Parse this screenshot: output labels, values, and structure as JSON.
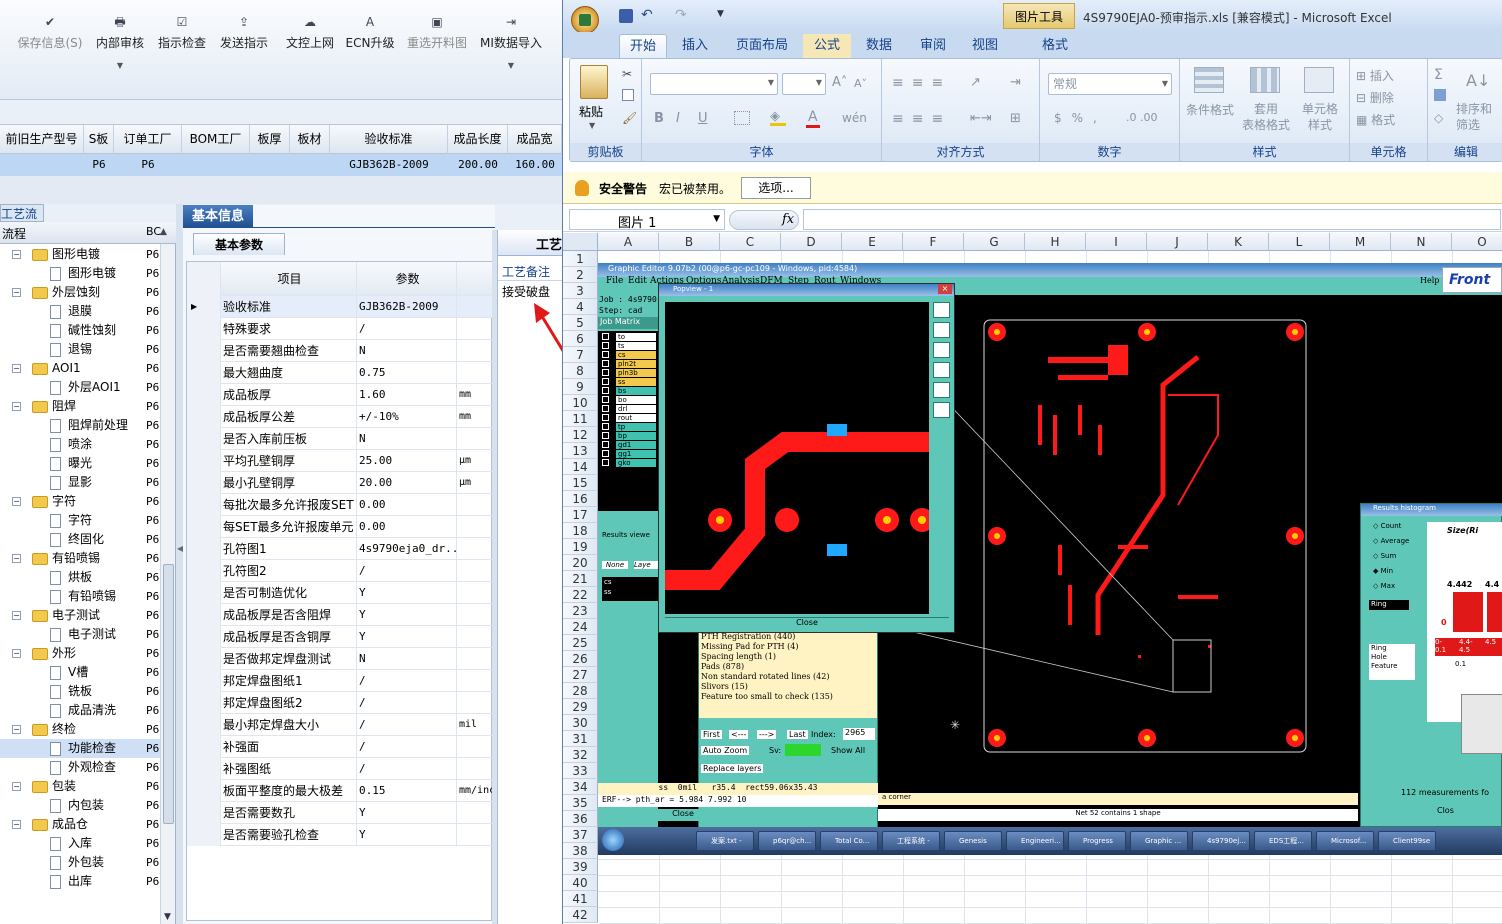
{
  "toolbar": {
    "buttons": [
      {
        "label": "保存信息(S)",
        "icon": "check-icon",
        "enabled": false
      },
      {
        "label": "内部审核",
        "icon": "printer-icon",
        "enabled": true
      },
      {
        "label": "指示检查",
        "icon": "checkbox-icon",
        "enabled": true
      },
      {
        "label": "发送指示",
        "icon": "upload-icon",
        "enabled": true
      },
      {
        "label": "文控上网",
        "icon": "cloud-upload-icon",
        "enabled": true
      },
      {
        "label": "ECN升级",
        "icon": "ecn-icon",
        "enabled": true
      },
      {
        "label": "重选开料图",
        "icon": "image-icon",
        "enabled": false
      },
      {
        "label": "MI数据导入",
        "icon": "import-icon",
        "enabled": true
      }
    ]
  },
  "order_table": {
    "headers": [
      "前旧生产型号",
      "S板",
      "订单工厂",
      "BOM工厂",
      "板厚",
      "板材",
      "验收标准",
      "成品长度",
      "成品宽"
    ],
    "row": [
      "",
      "P6",
      "P6",
      "",
      "",
      "",
      "GJB362B-2009",
      "200.00",
      "160.00"
    ]
  },
  "process": {
    "title": "工艺流程",
    "col1": "流程",
    "col2": "BC",
    "items": [
      {
        "label": "图形电镀",
        "level": 1,
        "code": "P6"
      },
      {
        "label": "图形电镀",
        "level": 2,
        "code": "P6"
      },
      {
        "label": "外层蚀刻",
        "level": 1,
        "code": "P6"
      },
      {
        "label": "退膜",
        "level": 2,
        "code": "P6"
      },
      {
        "label": "碱性蚀刻",
        "level": 2,
        "code": "P6"
      },
      {
        "label": "退锡",
        "level": 2,
        "code": "P6"
      },
      {
        "label": "AOI1",
        "level": 1,
        "code": "P6"
      },
      {
        "label": "外层AOI1",
        "level": 2,
        "code": "P6"
      },
      {
        "label": "阻焊",
        "level": 1,
        "code": "P6"
      },
      {
        "label": "阻焊前处理",
        "level": 2,
        "code": "P6"
      },
      {
        "label": "喷涂",
        "level": 2,
        "code": "P6"
      },
      {
        "label": "曝光",
        "level": 2,
        "code": "P6"
      },
      {
        "label": "显影",
        "level": 2,
        "code": "P6"
      },
      {
        "label": "字符",
        "level": 1,
        "code": "P6"
      },
      {
        "label": "字符",
        "level": 2,
        "code": "P6"
      },
      {
        "label": "终固化",
        "level": 2,
        "code": "P6"
      },
      {
        "label": "有铅喷锡",
        "level": 1,
        "code": "P6"
      },
      {
        "label": "烘板",
        "level": 2,
        "code": "P6"
      },
      {
        "label": "有铅喷锡",
        "level": 2,
        "code": "P6"
      },
      {
        "label": "电子测试",
        "level": 1,
        "code": "P6"
      },
      {
        "label": "电子测试",
        "level": 2,
        "code": "P6"
      },
      {
        "label": "外形",
        "level": 1,
        "code": "P6"
      },
      {
        "label": "V槽",
        "level": 2,
        "code": "P6"
      },
      {
        "label": "铣板",
        "level": 2,
        "code": "P6"
      },
      {
        "label": "成品清洗",
        "level": 2,
        "code": "P6"
      },
      {
        "label": "终检",
        "level": 1,
        "code": "P6"
      },
      {
        "label": "功能检查",
        "level": 2,
        "code": "P6",
        "selected": true
      },
      {
        "label": "外观检查",
        "level": 2,
        "code": "P6"
      },
      {
        "label": "包装",
        "level": 1,
        "code": "P6"
      },
      {
        "label": "内包装",
        "level": 2,
        "code": "P6"
      },
      {
        "label": "成品仓",
        "level": 1,
        "code": "P6"
      },
      {
        "label": "入库",
        "level": 2,
        "code": "P6"
      },
      {
        "label": "外包装",
        "level": 2,
        "code": "P6"
      },
      {
        "label": "出库",
        "level": 2,
        "code": "P6"
      }
    ]
  },
  "basic_info": {
    "tab": "基本信息",
    "subtab": "基本参数",
    "col_item": "项目",
    "col_param": "参数",
    "rows": [
      {
        "k": "验收标准",
        "v": "GJB362B-2009",
        "u": ""
      },
      {
        "k": "特殊要求",
        "v": "/",
        "u": ""
      },
      {
        "k": "是否需要翘曲检查",
        "v": "N",
        "u": ""
      },
      {
        "k": "最大翘曲度",
        "v": "0.75",
        "u": ""
      },
      {
        "k": "成品板厚",
        "v": "1.60",
        "u": "mm"
      },
      {
        "k": "成品板厚公差",
        "v": "+/-10%",
        "u": "mm"
      },
      {
        "k": "是否入库前压板",
        "v": "N",
        "u": ""
      },
      {
        "k": "平均孔壁铜厚",
        "v": "25.00",
        "u": "μm"
      },
      {
        "k": "最小孔壁铜厚",
        "v": "20.00",
        "u": "μm"
      },
      {
        "k": "每批次最多允许报废SET",
        "v": "0.00",
        "u": ""
      },
      {
        "k": "每SET最多允许报废单元",
        "v": "0.00",
        "u": ""
      },
      {
        "k": "孔符图1",
        "v": "4s9790eja0_dr...",
        "u": ""
      },
      {
        "k": "孔符图2",
        "v": "/",
        "u": ""
      },
      {
        "k": "是否可制造优化",
        "v": "Y",
        "u": ""
      },
      {
        "k": "成品板厚是否含阻焊",
        "v": "Y",
        "u": ""
      },
      {
        "k": "成品板厚是否含铜厚",
        "v": "Y",
        "u": ""
      },
      {
        "k": "是否做邦定焊盘测试",
        "v": "N",
        "u": ""
      },
      {
        "k": "邦定焊盘图纸1",
        "v": "/",
        "u": ""
      },
      {
        "k": "邦定焊盘图纸2",
        "v": "/",
        "u": ""
      },
      {
        "k": "最小邦定焊盘大小",
        "v": "/",
        "u": "mil"
      },
      {
        "k": "补强面",
        "v": "/",
        "u": ""
      },
      {
        "k": "补强图纸",
        "v": "/",
        "u": ""
      },
      {
        "k": "板面平整度的最大极差",
        "v": "0.15",
        "u": "mm/inc"
      },
      {
        "k": "是否需要数孔",
        "v": "Y",
        "u": ""
      },
      {
        "k": "是否需要验孔检查",
        "v": "Y",
        "u": ""
      }
    ]
  },
  "craft": {
    "tab": "工艺",
    "header": "工艺备注",
    "note": "接受破盘"
  },
  "excel": {
    "title": "4S9790EJA0-预审指示.xls  [兼容模式] - Microsoft Excel",
    "context_tab": "图片工具",
    "tabs": [
      "开始",
      "插入",
      "页面布局",
      "公式",
      "数据",
      "审阅",
      "视图",
      "格式"
    ],
    "groups": [
      "剪贴板",
      "字体",
      "对齐方式",
      "数字",
      "样式",
      "单元格",
      "编辑"
    ],
    "paste": "粘贴",
    "number_format": "常规",
    "style_btns": [
      "条件格式",
      "套用\n表格格式",
      "单元格\n样式"
    ],
    "cell_btns": [
      "插入",
      "删除",
      "格式"
    ],
    "edit_btns": [
      "排序和\n筛选"
    ],
    "security_title": "安全警告",
    "security_msg": "宏已被禁用。",
    "options_btn": "选项...",
    "name_box": "图片 1",
    "fx": "fx",
    "columns": [
      "A",
      "B",
      "C",
      "D",
      "E",
      "F",
      "G",
      "H",
      "I",
      "J",
      "K",
      "L",
      "M",
      "N",
      "O"
    ],
    "rows": [
      "1",
      "2",
      "3",
      "4",
      "5",
      "6",
      "7",
      "8",
      "9",
      "10",
      "11",
      "12",
      "13",
      "14",
      "15",
      "16",
      "17",
      "18",
      "19",
      "20",
      "21",
      "22",
      "23",
      "24",
      "25",
      "26",
      "27",
      "28",
      "29",
      "30",
      "31",
      "32",
      "33",
      "34",
      "35",
      "36",
      "37",
      "38",
      "39",
      "40",
      "41",
      "42"
    ]
  },
  "genesis": {
    "title": "Graphic Editor 9.07b2 (00@p6-gc-pc109 - Windows, pid:4584)",
    "menus": [
      "File",
      "Edit",
      "Actions",
      "Options",
      "Analysis",
      "DFM",
      "Step",
      "Rout",
      "Windows"
    ],
    "help": "Help",
    "brand": "Front",
    "job": "Job : 4s9790",
    "step": "Step: cad",
    "matrix": "Job Matrix",
    "layers": [
      "to",
      "ts",
      "cs",
      "pln2t",
      "pln3b",
      "ss",
      "bs",
      "bo",
      "drl",
      "rout",
      "tp",
      "bp",
      "gd1",
      "gg1",
      "gko"
    ],
    "popup_title": "Popview - 1",
    "popup_close": "Close",
    "results_title": "Results viewe",
    "results_cols": [
      "None",
      "Laye"
    ],
    "results_layers": [
      "cs",
      "ss"
    ],
    "results_lines": [
      "PTH Registration (440)",
      "Missing Pad for PTH (4)",
      "Spacing length (1)",
      "Pads (878)",
      "Non standard rotated lines (42)",
      "Slivors (15)",
      "Feature too small to check (135)"
    ],
    "first": "First",
    "prev": "<---",
    "next": "--->",
    "last": "Last",
    "index_label": "Index:",
    "index_val": "2965",
    "auto_zoom": "Auto Zoom",
    "sv": "Sv:",
    "show_all": "Show All",
    "replace": "Replace layers",
    "status1": "ss  0mil   r35.4  rect59.06x35.43",
    "status2": "ERF--> pth_ar = 5.984 7.992 10",
    "close": "Close",
    "corner": "a corner",
    "net_msg": "Net 52 contains 1 shape",
    "hist_title": "Results histogram",
    "hist_opts": [
      "Count",
      "Average",
      "Sum",
      "Min",
      "Max"
    ],
    "hist_sel": "Ring",
    "hist_size": "Size(Ri",
    "hist_vals": [
      "4.442",
      "4.4"
    ],
    "hist_bins": [
      "0-\n0.1",
      "4.4-\n4.5",
      "4.5"
    ],
    "hist_tags": [
      "Ring",
      "Hole",
      "Feature"
    ],
    "hist_num": "0.1",
    "hist_meas": "112 measurements fo",
    "hist_close": "Clos",
    "taskbar": [
      "发案.txt -",
      "p6qr@ch...",
      "Total Co...",
      "工程系统 -",
      "Genesis",
      "Engineeri...",
      "Progress",
      "Graphic ...",
      "4s9790ej...",
      "EDS工程...",
      "Microsof...",
      "Client99se"
    ]
  }
}
